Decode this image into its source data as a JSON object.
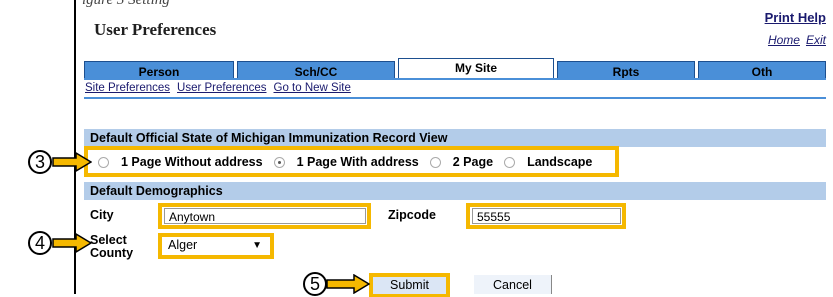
{
  "caption": "igure 3 Setting",
  "page_title": "User Preferences",
  "links": {
    "print_help": "Print Help",
    "home": "Home",
    "exit": "Exit"
  },
  "tabs": [
    {
      "label": "Person"
    },
    {
      "label": "Sch/CC"
    },
    {
      "label": "My Site",
      "active": true
    },
    {
      "label": "Rpts"
    },
    {
      "label": "Oth"
    }
  ],
  "subnav": {
    "site_prefs": "Site Preferences",
    "user_prefs": "User Preferences",
    "new_site": "Go to New Site"
  },
  "record_view": {
    "header": "Default Official State of Michigan Immunization Record View",
    "options": [
      "1 Page Without address",
      "1 Page With address",
      "2 Page",
      "Landscape"
    ],
    "selected": "1 Page With address"
  },
  "demographics": {
    "header": "Default Demographics",
    "city_label": "City",
    "city_value": "Anytown",
    "zip_label": "Zipcode",
    "zip_value": "55555",
    "county_label_1": "Select",
    "county_label_2": "County",
    "county_value": "Alger"
  },
  "buttons": {
    "submit": "Submit",
    "cancel": "Cancel"
  },
  "callouts": [
    "3",
    "4",
    "5"
  ],
  "colors": {
    "highlight": "#f5b800",
    "tab": "#4a8fd8",
    "section": "#b3cce9"
  }
}
